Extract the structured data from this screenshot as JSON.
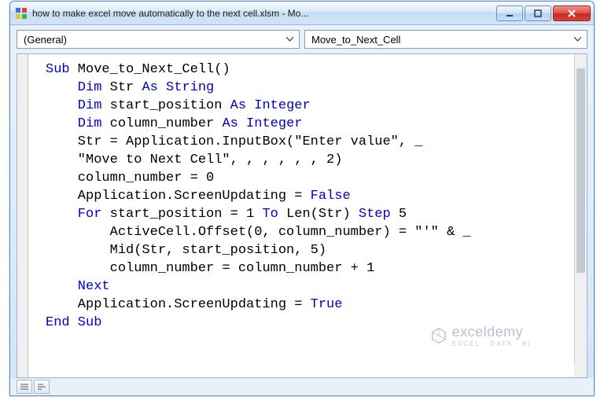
{
  "titlebar": {
    "title": "how to make excel move automatically to the next cell.xlsm - Mo..."
  },
  "dropdowns": {
    "left": "(General)",
    "right": "Move_to_Next_Cell"
  },
  "code": {
    "l1_a": "Sub",
    "l1_b": " Move_to_Next_Cell()",
    "l2_a": "    Dim",
    "l2_b": " Str ",
    "l2_c": "As String",
    "l3_a": "    Dim",
    "l3_b": " start_position ",
    "l3_c": "As Integer",
    "l4_a": "    Dim",
    "l4_b": " column_number ",
    "l4_c": "As Integer",
    "l5": "    Str = Application.InputBox(\"Enter value\", _",
    "l6": "    \"Move to Next Cell\", , , , , , 2)",
    "l7": "    column_number = 0",
    "l8_a": "    Application.ScreenUpdating = ",
    "l8_b": "False",
    "l9_a": "    For",
    "l9_b": " start_position = 1 ",
    "l9_c": "To",
    "l9_d": " Len(Str) ",
    "l9_e": "Step",
    "l9_f": " 5",
    "l10": "        ActiveCell.Offset(0, column_number) = \"'\" & _",
    "l11": "        Mid(Str, start_position, 5)",
    "l12": "        column_number = column_number + 1",
    "l13": "    Next",
    "l14_a": "    Application.ScreenUpdating = ",
    "l14_b": "True",
    "l15": "End Sub"
  },
  "watermark": {
    "main": "exceldemy",
    "sub": "EXCEL · DATA · BI"
  }
}
